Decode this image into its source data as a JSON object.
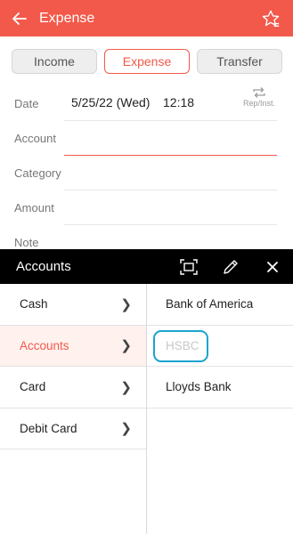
{
  "appbar": {
    "title": "Expense",
    "back_icon": "arrow-left-icon",
    "star_icon": "star-outline-icon",
    "color": "#f2594b"
  },
  "tabs": [
    {
      "label": "Income",
      "active": false
    },
    {
      "label": "Expense",
      "active": true
    },
    {
      "label": "Transfer",
      "active": false
    }
  ],
  "form": {
    "date": {
      "label": "Date",
      "value": "5/25/22 (Wed)",
      "time": "12:18",
      "repeat_label": "Rep/Inst."
    },
    "account": {
      "label": "Account",
      "value": ""
    },
    "category": {
      "label": "Category",
      "value": ""
    },
    "amount": {
      "label": "Amount",
      "value": ""
    },
    "note": {
      "label": "Note",
      "value": ""
    }
  },
  "panel": {
    "title": "Accounts",
    "icons": [
      "screen-capture-icon",
      "pencil-icon",
      "close-icon"
    ],
    "groups": [
      {
        "label": "Cash",
        "selected": false
      },
      {
        "label": "Accounts",
        "selected": true
      },
      {
        "label": "Card",
        "selected": false
      },
      {
        "label": "Debit Card",
        "selected": false
      }
    ],
    "accounts": [
      {
        "label": "Bank of America",
        "dimmed": false
      },
      {
        "label": "HSBC",
        "dimmed": true,
        "highlighted": true
      },
      {
        "label": "Lloyds Bank",
        "dimmed": false
      }
    ]
  }
}
